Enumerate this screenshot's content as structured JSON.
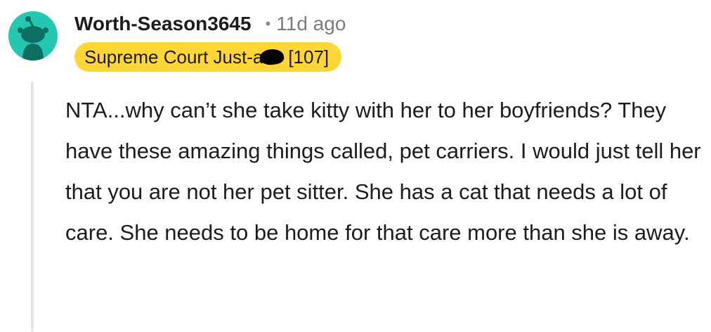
{
  "comment": {
    "author": "Worth-Season3645",
    "separator": "•",
    "timestamp": "11d ago",
    "flair": {
      "text_before": "Supreme Court Just-a",
      "text_after": "[107]",
      "color": "#ffd635"
    },
    "avatar": {
      "icon": "snoo-avatar-icon",
      "color": "#24c7b0"
    },
    "body": "NTA...why can’t she take kitty with her to her boyfriends? They have these amazing things called, pet carriers. I would just tell her that you are not her pet sitter. She has a cat that needs a lot of care. She needs to be home for that care more than she is away."
  }
}
